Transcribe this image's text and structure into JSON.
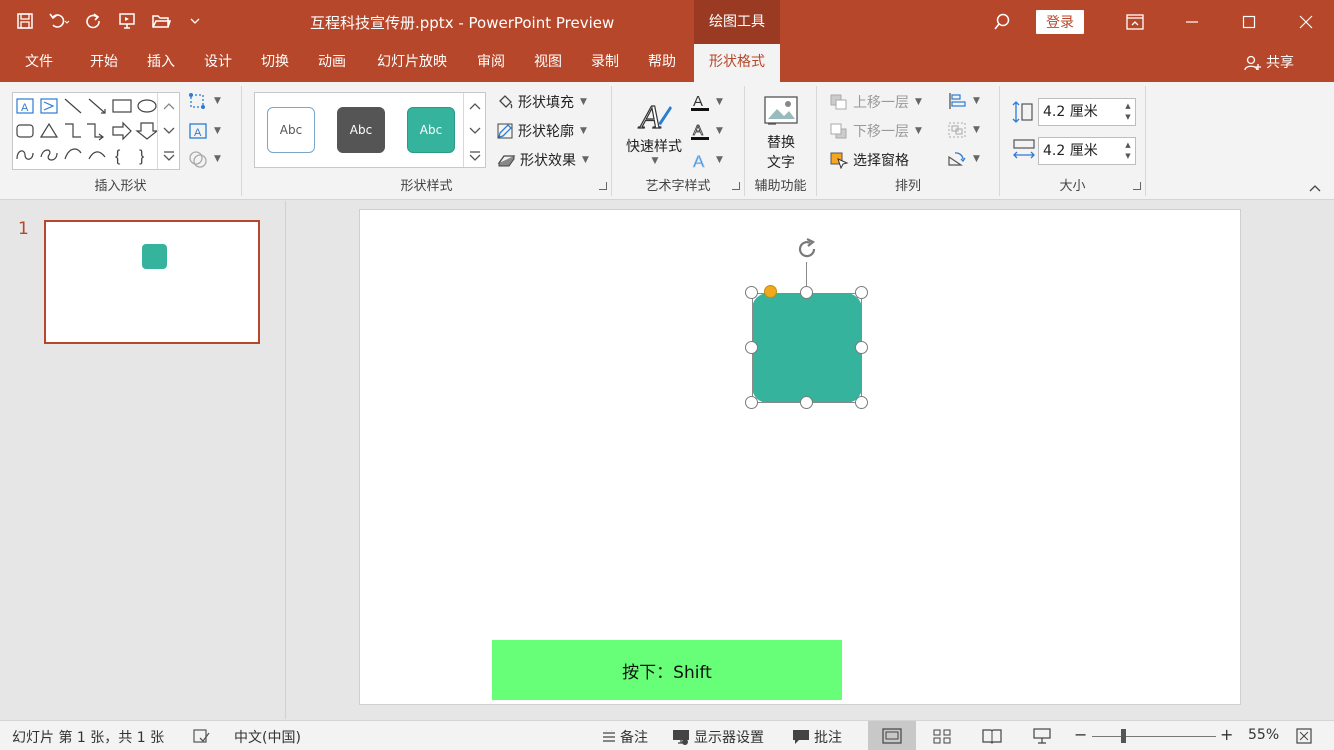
{
  "titlebar": {
    "doc_title": "互程科技宣传册.pptx  -  PowerPoint Preview",
    "context_group": "绘图工具",
    "login": "登录"
  },
  "tabs": [
    {
      "label": "文件"
    },
    {
      "label": "开始"
    },
    {
      "label": "插入"
    },
    {
      "label": "设计"
    },
    {
      "label": "切换"
    },
    {
      "label": "动画"
    },
    {
      "label": "幻灯片放映"
    },
    {
      "label": "审阅"
    },
    {
      "label": "视图"
    },
    {
      "label": "录制"
    },
    {
      "label": "帮助"
    },
    {
      "label": "形状格式"
    }
  ],
  "share": "共享",
  "ribbon": {
    "insert_shapes": {
      "label": "插入形状"
    },
    "shape_styles": {
      "label": "形状样式",
      "presets": [
        "Abc",
        "Abc",
        "Abc"
      ],
      "fill": "形状填充",
      "outline": "形状轮廓",
      "effects": "形状效果"
    },
    "wordart": {
      "label": "艺术字样式",
      "quick_styles": "快速样式"
    },
    "accessibility": {
      "label": "辅助功能",
      "alt_text_line1": "替换",
      "alt_text_line2": "文字"
    },
    "arrange": {
      "label": "排列",
      "bring_forward": "上移一层",
      "send_backward": "下移一层",
      "selection_pane": "选择窗格"
    },
    "size": {
      "label": "大小",
      "height": "4.2 厘米",
      "width": "4.2 厘米"
    }
  },
  "thumbnails": {
    "slide_number": "1"
  },
  "slide": {
    "key_banner": "按下：Shift"
  },
  "status": {
    "slide_info": "幻灯片 第 1 张，共 1 张",
    "language": "中文(中国)",
    "notes": "备注",
    "display_settings": "显示器设置",
    "comments": "批注",
    "zoom": "55%"
  },
  "colors": {
    "accent": "#b7472a",
    "shape_fill": "#35b39d",
    "banner": "#66ff77"
  }
}
